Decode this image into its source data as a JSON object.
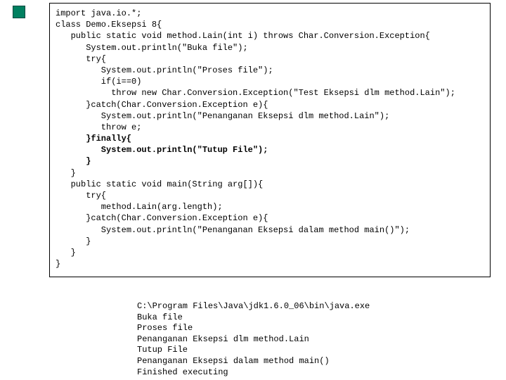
{
  "code": {
    "lines": [
      {
        "text": "import java.io.*;",
        "bold": false
      },
      {
        "text": "",
        "bold": false
      },
      {
        "text": "class Demo.Eksepsi 8{",
        "bold": false
      },
      {
        "text": "   public static void method.Lain(int i) throws Char.Conversion.Exception{",
        "bold": false
      },
      {
        "text": "      System.out.println(\"Buka file\");",
        "bold": false
      },
      {
        "text": "      try{",
        "bold": false
      },
      {
        "text": "         System.out.println(\"Proses file\");",
        "bold": false
      },
      {
        "text": "         if(i==0)",
        "bold": false
      },
      {
        "text": "           throw new Char.Conversion.Exception(\"Test Eksepsi dlm method.Lain\");",
        "bold": false
      },
      {
        "text": "      }catch(Char.Conversion.Exception e){",
        "bold": false
      },
      {
        "text": "         System.out.println(\"Penanganan Eksepsi dlm method.Lain\");",
        "bold": false
      },
      {
        "text": "         throw e;",
        "bold": false
      },
      {
        "text": "      }finally{",
        "bold": true
      },
      {
        "text": "         System.out.println(\"Tutup File\");",
        "bold": true
      },
      {
        "text": "      }",
        "bold": true
      },
      {
        "text": "   }",
        "bold": false
      },
      {
        "text": "",
        "bold": false
      },
      {
        "text": "   public static void main(String arg[]){",
        "bold": false
      },
      {
        "text": "      try{",
        "bold": false
      },
      {
        "text": "         method.Lain(arg.length);",
        "bold": false
      },
      {
        "text": "      }catch(Char.Conversion.Exception e){",
        "bold": false
      },
      {
        "text": "         System.out.println(\"Penanganan Eksepsi dalam method main()\");",
        "bold": false
      },
      {
        "text": "      }",
        "bold": false
      },
      {
        "text": "   }",
        "bold": false
      },
      {
        "text": "}",
        "bold": false
      }
    ]
  },
  "output": {
    "lines": [
      "C:\\Program Files\\Java\\jdk1.6.0_06\\bin\\java.exe",
      "Buka file",
      "Proses file",
      "Penanganan Eksepsi dlm method.Lain",
      "Tutup File",
      "Penanganan Eksepsi dalam method main()",
      "Finished executing"
    ]
  }
}
